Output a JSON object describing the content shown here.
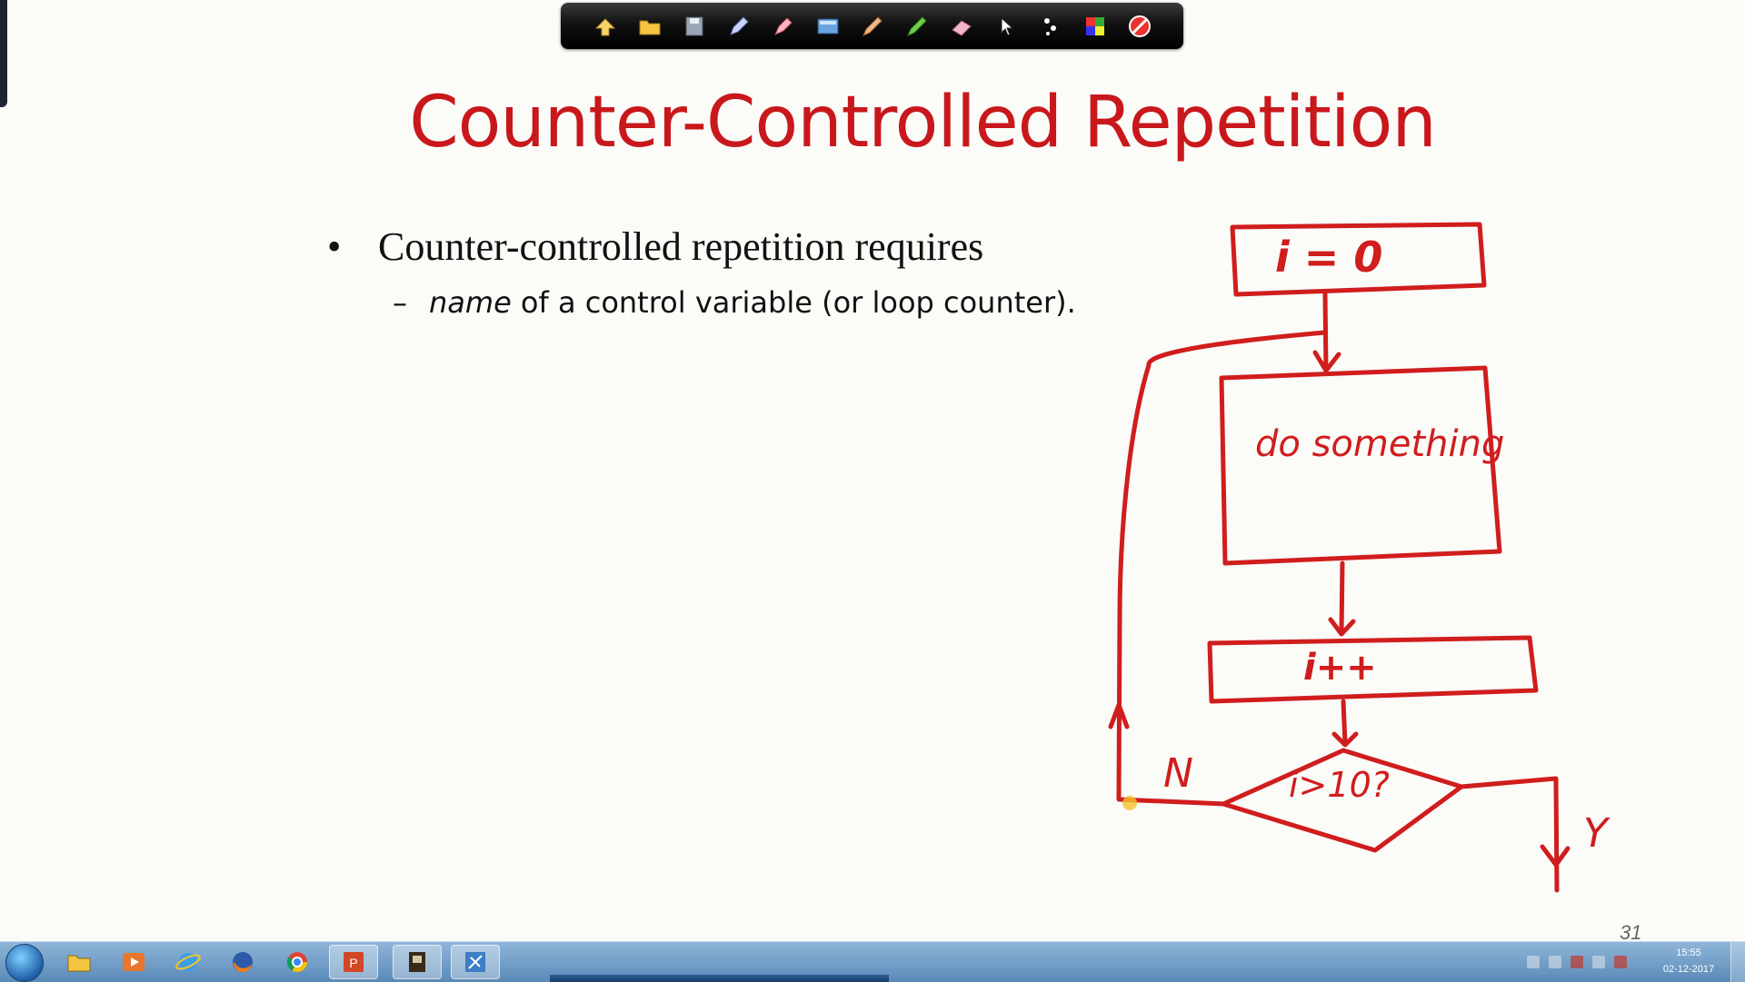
{
  "slide": {
    "title": "Counter-Controlled Repetition",
    "bullet": "Counter-controlled repetition requires",
    "sub_bullet_dash": "–",
    "sub_bullet_emphasis": "name",
    "sub_bullet_rest": " of a control variable (or loop counter).",
    "page_number": "31"
  },
  "flowchart": {
    "init": "i = 0",
    "body": "do something",
    "increment": "i++",
    "condition": "i>10?",
    "no_label": "N",
    "yes_label": "Y",
    "ink_color": "#d01d1d"
  },
  "ink_toolbar": {
    "tools": [
      "previous-arrow",
      "open-folder",
      "save",
      "pen",
      "highlighter",
      "screen-capture",
      "pencil",
      "marker",
      "eraser",
      "pointer",
      "laser-dots",
      "color-palette",
      "stop"
    ]
  },
  "taskbar": {
    "apps": [
      "explorer",
      "media-player",
      "internet-explorer",
      "firefox",
      "chrome",
      "powerpoint",
      "presentation-app",
      "tool-app"
    ],
    "clock_time": "15:55",
    "clock_date": "02-12-2017"
  }
}
